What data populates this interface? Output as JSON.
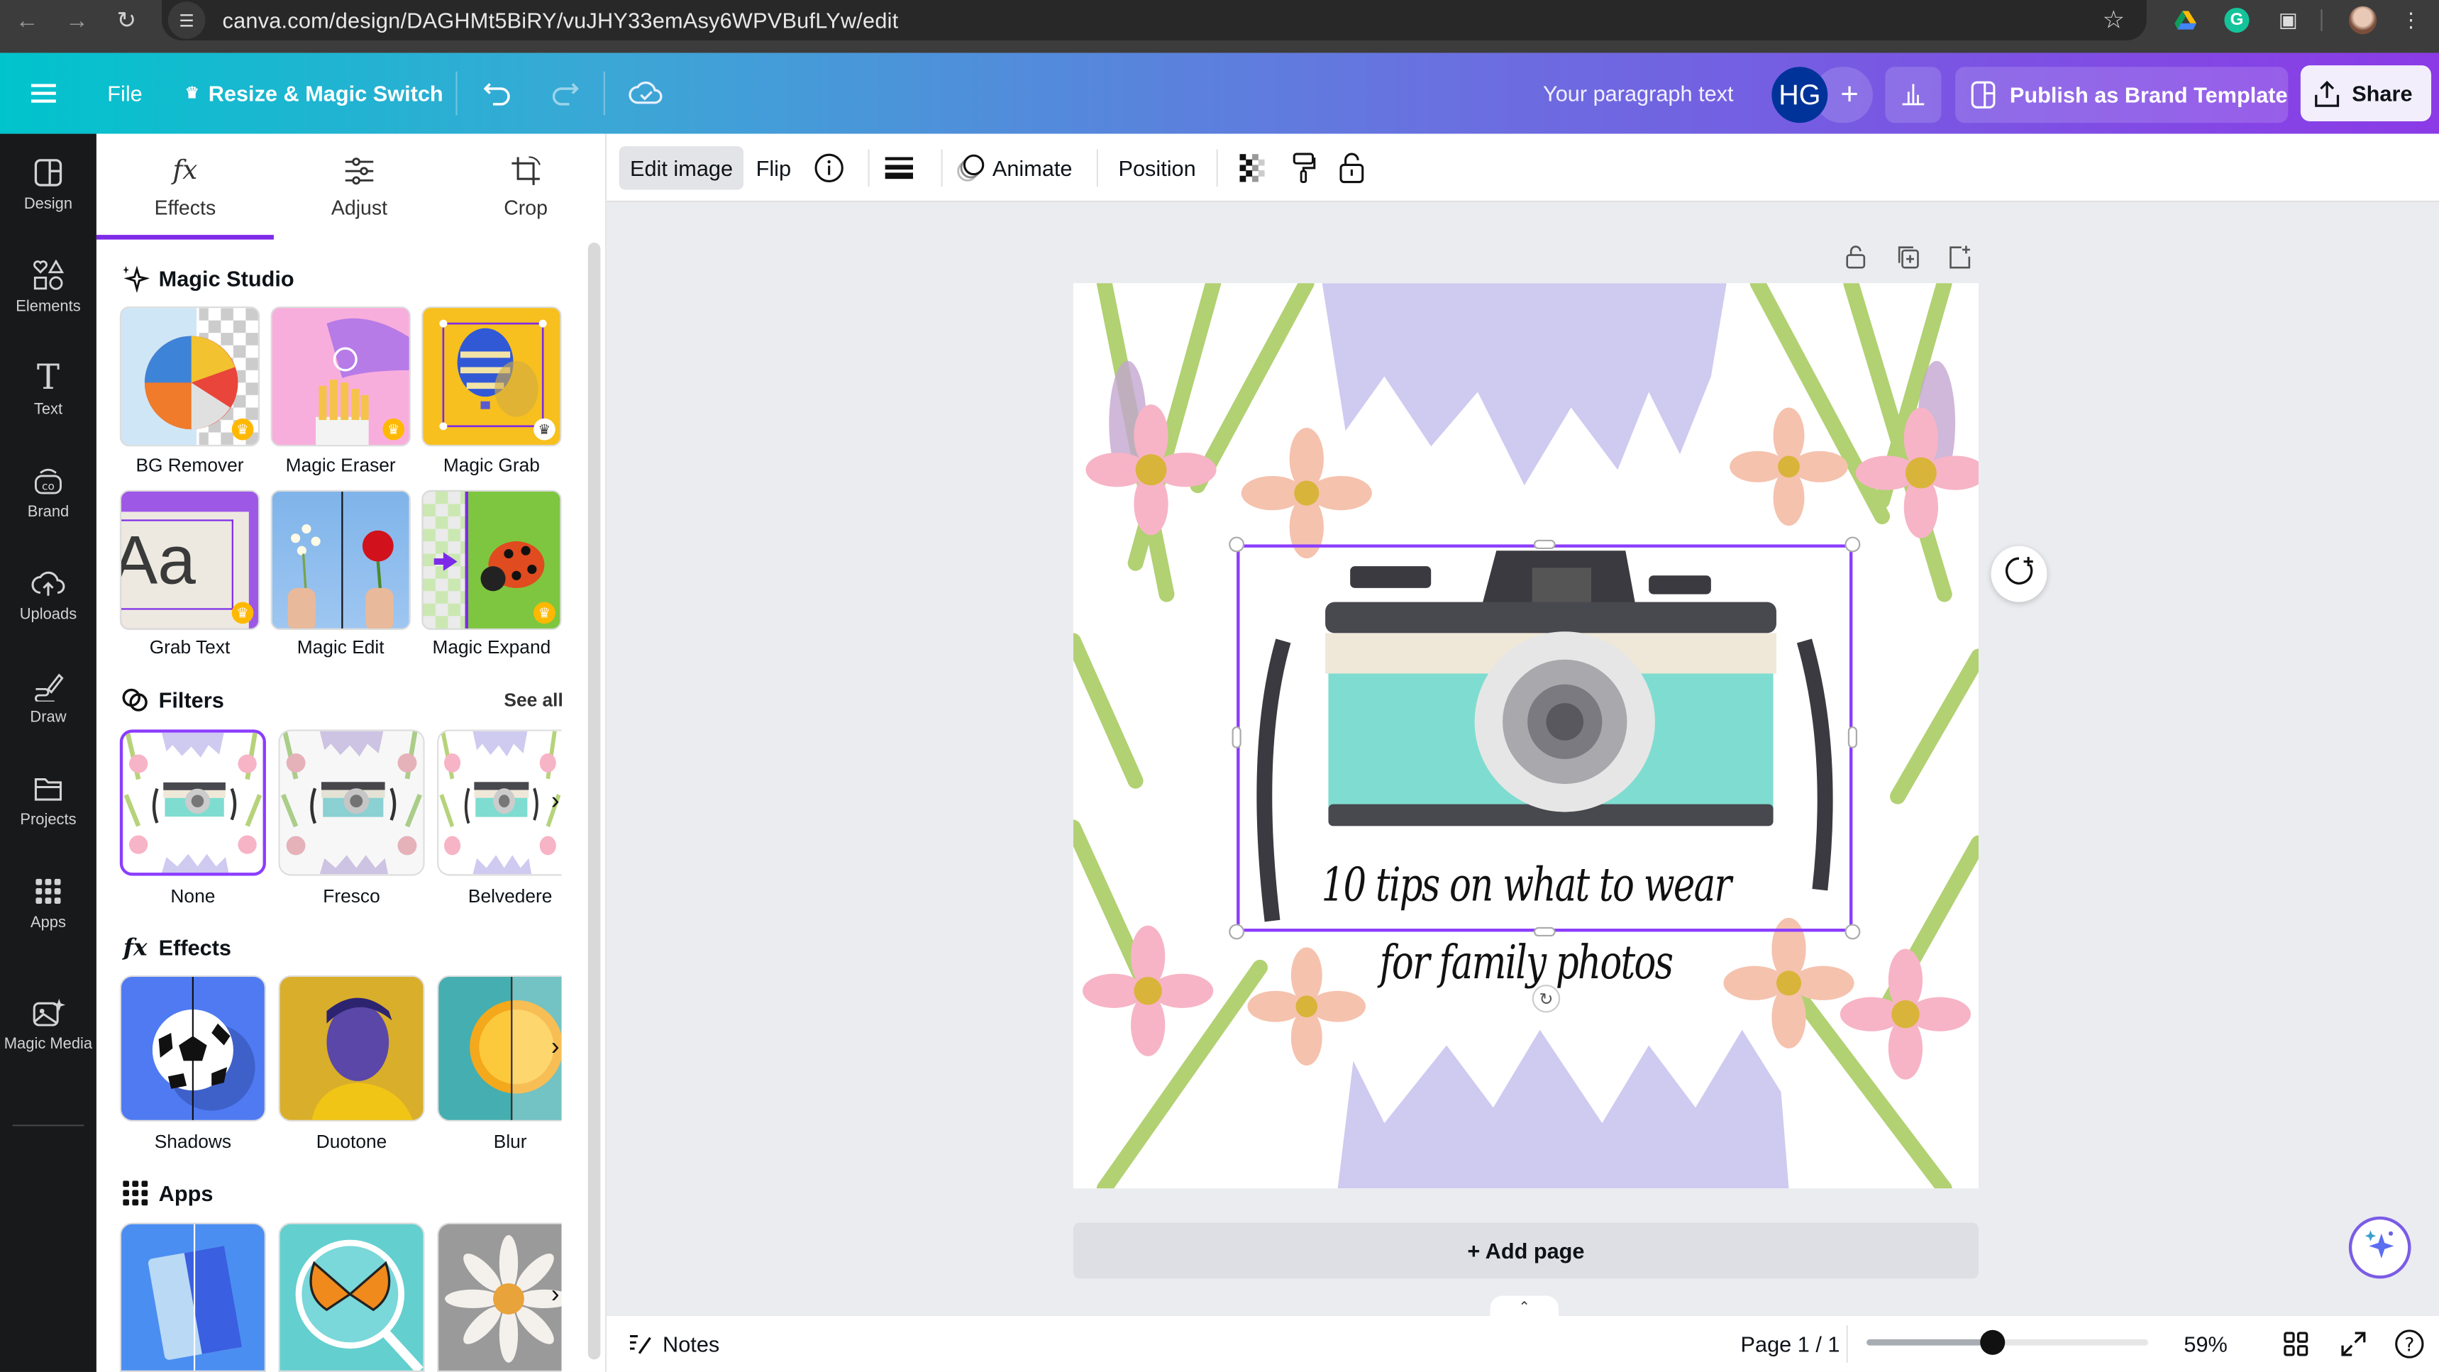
{
  "browser": {
    "url": "canva.com/design/DAGHMt5BiRY/vuJHY33emAsy6WPVBufLYw/edit",
    "icons": [
      "back-icon",
      "forward-icon",
      "reload-icon",
      "site-settings-icon",
      "bookmark-star-icon",
      "google-drive-icon",
      "grammarly-icon",
      "extensions-icon",
      "profile-avatar",
      "menu-icon"
    ]
  },
  "topbar": {
    "menu_icon": "hamburger-icon",
    "file_label": "File",
    "resize_label": "Resize & Magic Switch",
    "undo_icon": "undo-icon",
    "redo_icon": "redo-icon",
    "save_status_icon": "cloud-check-icon",
    "design_title": "Your paragraph text",
    "avatar_initials": "HG",
    "add_collaborator": "+",
    "insights_icon": "bar-chart-icon",
    "publish_label": "Publish as Brand Template",
    "share_label": "Share"
  },
  "rail": {
    "items": [
      {
        "label": "Design",
        "icon": "design-icon"
      },
      {
        "label": "Elements",
        "icon": "elements-icon"
      },
      {
        "label": "Text",
        "icon": "text-icon"
      },
      {
        "label": "Brand",
        "icon": "brand-icon"
      },
      {
        "label": "Uploads",
        "icon": "upload-icon"
      },
      {
        "label": "Draw",
        "icon": "draw-icon"
      },
      {
        "label": "Projects",
        "icon": "folder-icon"
      },
      {
        "label": "Apps",
        "icon": "apps-grid-icon"
      },
      {
        "label": "Magic Media",
        "icon": "magic-media-icon"
      }
    ]
  },
  "panel": {
    "tabs": [
      {
        "label": "Effects",
        "active": true
      },
      {
        "label": "Adjust",
        "active": false
      },
      {
        "label": "Crop",
        "active": false
      }
    ],
    "magic_studio": {
      "title": "Magic Studio",
      "tools": [
        {
          "label": "BG Remover",
          "premium": true
        },
        {
          "label": "Magic Eraser",
          "premium": true
        },
        {
          "label": "Magic Grab",
          "premium": true
        },
        {
          "label": "Grab Text",
          "premium": true
        },
        {
          "label": "Magic Edit",
          "premium": false
        },
        {
          "label": "Magic Expand",
          "premium": true
        }
      ]
    },
    "filters": {
      "title": "Filters",
      "see_all": "See all",
      "items": [
        {
          "label": "None",
          "selected": true
        },
        {
          "label": "Fresco",
          "selected": false
        },
        {
          "label": "Belvedere",
          "selected": false
        }
      ]
    },
    "effects": {
      "title": "Effects",
      "items": [
        {
          "label": "Shadows"
        },
        {
          "label": "Duotone"
        },
        {
          "label": "Blur"
        }
      ]
    },
    "apps": {
      "title": "Apps"
    }
  },
  "edit_toolbar": {
    "edit_image": "Edit image",
    "flip": "Flip",
    "info_icon": "info-icon",
    "layers_icon": "lines-icon",
    "animate": "Animate",
    "position": "Position",
    "transparency_icon": "transparency-icon",
    "paint_roller_icon": "copy-style-icon",
    "lock_icon": "lock-icon"
  },
  "canvas": {
    "title_line1": "10 tips on what to wear",
    "title_line2": "for family photos",
    "add_page": "+ Add page",
    "colors": {
      "selection": "#8b3dff",
      "camera_body": "#7fdcd0",
      "lavender": "#c9c3ee",
      "leaf": "#a4c95a",
      "petal": "#f7b7c4",
      "peach": "#f4c2ac"
    }
  },
  "footer": {
    "notes": "Notes",
    "page_indicator": "Page 1 / 1",
    "zoom_percent": "59%",
    "zoom_value": 0.59
  }
}
